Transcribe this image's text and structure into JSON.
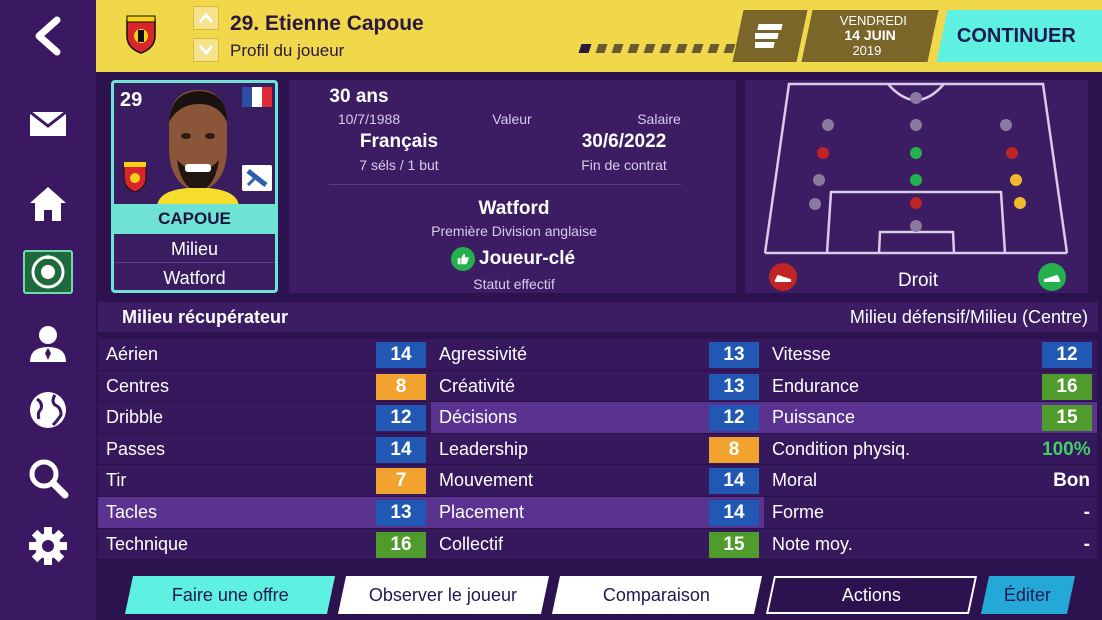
{
  "header": {
    "player_title": "29. Etienne Capoue",
    "subtitle": "Profil du joueur",
    "date": {
      "day": "VENDREDI",
      "date": "14 JUIN",
      "year": "2019"
    },
    "continue_label": "CONTINUER",
    "club_logo_text": "WATFORD"
  },
  "card": {
    "number": "29",
    "name": "CAPOUE",
    "position": "Milieu",
    "team": "Watford"
  },
  "info": {
    "age": "30 ans",
    "birthdate": "10/7/1988",
    "value_label": "Valeur",
    "salary_label": "Salaire",
    "nationality": "Français",
    "caps": "7 séls / 1 but",
    "contract_end": "30/6/2022",
    "contract_label": "Fin de contrat",
    "club": "Watford",
    "league": "Première Division anglaise",
    "status": "Joueur-clé",
    "status_label": "Statut effectif"
  },
  "pitch": {
    "foot_label": "Droit"
  },
  "role": {
    "left": "Milieu récupérateur",
    "right": "Milieu défensif/Milieu (Centre)"
  },
  "attributes": {
    "col1": [
      {
        "label": "Aérien",
        "value": "14",
        "color": "blue"
      },
      {
        "label": "Centres",
        "value": "8",
        "color": "orange"
      },
      {
        "label": "Dribble",
        "value": "12",
        "color": "blue"
      },
      {
        "label": "Passes",
        "value": "14",
        "color": "blue"
      },
      {
        "label": "Tir",
        "value": "7",
        "color": "orange"
      },
      {
        "label": "Tacles",
        "value": "13",
        "color": "blue"
      },
      {
        "label": "Technique",
        "value": "16",
        "color": "green"
      }
    ],
    "col2": [
      {
        "label": "Agressivité",
        "value": "13",
        "color": "blue"
      },
      {
        "label": "Créativité",
        "value": "13",
        "color": "blue"
      },
      {
        "label": "Décisions",
        "value": "12",
        "color": "blue"
      },
      {
        "label": "Leadership",
        "value": "8",
        "color": "orange"
      },
      {
        "label": "Mouvement",
        "value": "14",
        "color": "blue"
      },
      {
        "label": "Placement",
        "value": "14",
        "color": "blue"
      },
      {
        "label": "Collectif",
        "value": "15",
        "color": "green"
      }
    ],
    "col3": [
      {
        "label": "Vitesse",
        "value": "12",
        "color": "blue"
      },
      {
        "label": "Endurance",
        "value": "16",
        "color": "green"
      },
      {
        "label": "Puissance",
        "value": "15",
        "color": "green"
      },
      {
        "label": "Condition physiq.",
        "value": "100%",
        "color": "pct"
      },
      {
        "label": "Moral",
        "value": "Bon",
        "color": "plain"
      },
      {
        "label": "Forme",
        "value": "-",
        "color": "plain"
      },
      {
        "label": "Note moy.",
        "value": "-",
        "color": "plain"
      }
    ]
  },
  "buttons": {
    "offer": "Faire une offre",
    "scout": "Observer le joueur",
    "compare": "Comparaison",
    "actions": "Actions",
    "edit": "Éditer"
  },
  "colors": {
    "topbar": "#f0d84a",
    "accent": "#5ef0e0",
    "blue": "#2158b4",
    "orange": "#f2a22e",
    "green": "#4f9c2c"
  }
}
